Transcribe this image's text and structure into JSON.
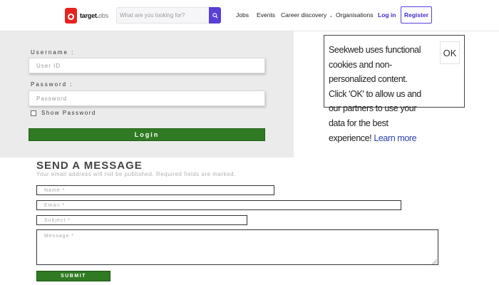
{
  "brand": {
    "logo_text_bold": "target",
    "logo_text_light": "obs"
  },
  "search": {
    "placeholder": "What are you looking for?"
  },
  "nav": {
    "items": [
      {
        "label": "Jobs"
      },
      {
        "label": "Events"
      },
      {
        "label": "Career discovery"
      },
      {
        "label": "Organisations"
      }
    ],
    "login_label": "Log in",
    "register_label": "Register"
  },
  "login": {
    "username_label": "Username :",
    "username_placeholder": "User ID",
    "password_label": "Password :",
    "password_placeholder": "Password",
    "show_password_label": "Show Password",
    "show_password_checked": false,
    "button_label": "Login"
  },
  "cookie_notice": {
    "text": "Seekweb uses functional cookies and non-personalized content. Click 'OK' to allow us and our partners to use your data for the best experience!",
    "learn_more": "Learn more",
    "ok_label": "OK"
  },
  "contact_form": {
    "title": "SEND A MESSAGE",
    "subtitle": "Your email address will not be published. Required fields are marked.",
    "name_placeholder": "Name *",
    "email_placeholder": "Email *",
    "subject_placeholder": "Subject *",
    "message_placeholder": "Message *",
    "submit_label": "SUBMIT"
  },
  "colors": {
    "accent_purple": "#5b3fd6",
    "login_green": "#2f7a22",
    "logo_red": "#e52421",
    "link_blue": "#2a3fb0"
  }
}
